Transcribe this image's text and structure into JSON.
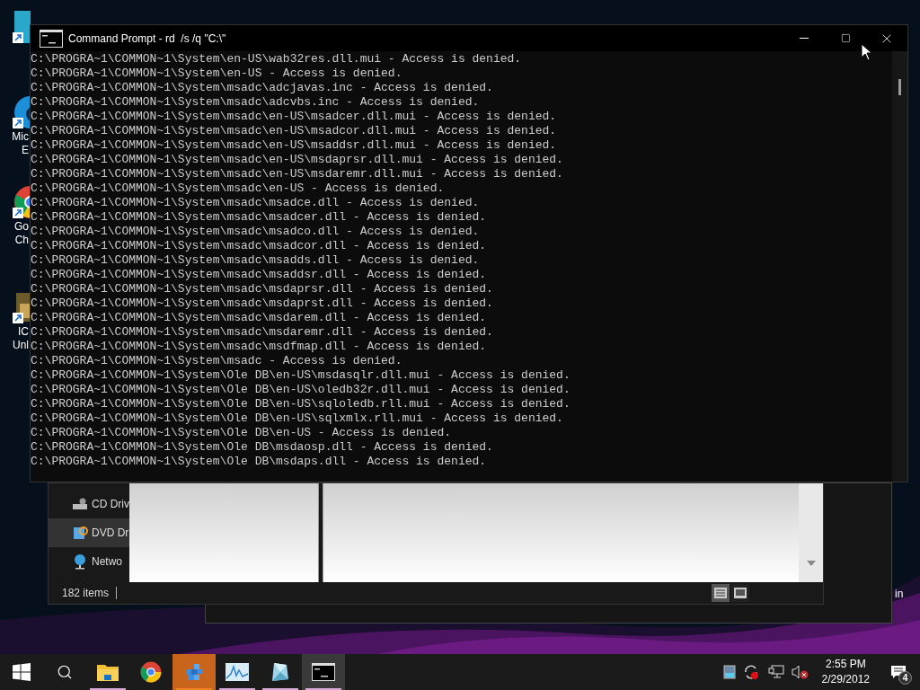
{
  "desktop": {
    "icons": [
      {
        "kind": "generic"
      },
      {
        "kind": "edge",
        "label_lines": [
          "Mic",
          "E"
        ]
      },
      {
        "kind": "chrome",
        "label_lines": [
          "Go",
          "Ch"
        ]
      },
      {
        "label_lines": [
          "IC",
          "Unl"
        ]
      }
    ],
    "right_label": "in"
  },
  "explorer": {
    "nav_items": [
      {
        "kind": "cd",
        "label": "CD Driv",
        "selected": false
      },
      {
        "kind": "dvd",
        "label": "DVD Dr",
        "selected": true
      },
      {
        "kind": "network",
        "label": "Netwo",
        "selected": false
      }
    ],
    "status": "182 items",
    "views": [
      {
        "kind": "details",
        "selected": true
      },
      {
        "kind": "tiles",
        "selected": false
      }
    ]
  },
  "console": {
    "title": "Command Prompt - rd  /s /q \"C:\\\"",
    "lines": [
      "C:\\PROGRA~1\\COMMON~1\\System\\en-US\\wab32res.dll.mui - Access is denied.",
      "C:\\PROGRA~1\\COMMON~1\\System\\en-US - Access is denied.",
      "C:\\PROGRA~1\\COMMON~1\\System\\msadc\\adcjavas.inc - Access is denied.",
      "C:\\PROGRA~1\\COMMON~1\\System\\msadc\\adcvbs.inc - Access is denied.",
      "C:\\PROGRA~1\\COMMON~1\\System\\msadc\\en-US\\msadcer.dll.mui - Access is denied.",
      "C:\\PROGRA~1\\COMMON~1\\System\\msadc\\en-US\\msadcor.dll.mui - Access is denied.",
      "C:\\PROGRA~1\\COMMON~1\\System\\msadc\\en-US\\msaddsr.dll.mui - Access is denied.",
      "C:\\PROGRA~1\\COMMON~1\\System\\msadc\\en-US\\msdaprsr.dll.mui - Access is denied.",
      "C:\\PROGRA~1\\COMMON~1\\System\\msadc\\en-US\\msdaremr.dll.mui - Access is denied.",
      "C:\\PROGRA~1\\COMMON~1\\System\\msadc\\en-US - Access is denied.",
      "C:\\PROGRA~1\\COMMON~1\\System\\msadc\\msadce.dll - Access is denied.",
      "C:\\PROGRA~1\\COMMON~1\\System\\msadc\\msadcer.dll - Access is denied.",
      "C:\\PROGRA~1\\COMMON~1\\System\\msadc\\msadco.dll - Access is denied.",
      "C:\\PROGRA~1\\COMMON~1\\System\\msadc\\msadcor.dll - Access is denied.",
      "C:\\PROGRA~1\\COMMON~1\\System\\msadc\\msadds.dll - Access is denied.",
      "C:\\PROGRA~1\\COMMON~1\\System\\msadc\\msaddsr.dll - Access is denied.",
      "C:\\PROGRA~1\\COMMON~1\\System\\msadc\\msdaprsr.dll - Access is denied.",
      "C:\\PROGRA~1\\COMMON~1\\System\\msadc\\msdaprst.dll - Access is denied.",
      "C:\\PROGRA~1\\COMMON~1\\System\\msadc\\msdarem.dll - Access is denied.",
      "C:\\PROGRA~1\\COMMON~1\\System\\msadc\\msdaremr.dll - Access is denied.",
      "C:\\PROGRA~1\\COMMON~1\\System\\msadc\\msdfmap.dll - Access is denied.",
      "C:\\PROGRA~1\\COMMON~1\\System\\msadc - Access is denied.",
      "C:\\PROGRA~1\\COMMON~1\\System\\Ole DB\\en-US\\msdasqlr.dll.mui - Access is denied.",
      "C:\\PROGRA~1\\COMMON~1\\System\\Ole DB\\en-US\\oledb32r.dll.mui - Access is denied.",
      "C:\\PROGRA~1\\COMMON~1\\System\\Ole DB\\en-US\\sqloledb.rll.mui - Access is denied.",
      "C:\\PROGRA~1\\COMMON~1\\System\\Ole DB\\en-US\\sqlxmlx.rll.mui - Access is denied.",
      "C:\\PROGRA~1\\COMMON~1\\System\\Ole DB\\en-US - Access is denied.",
      "C:\\PROGRA~1\\COMMON~1\\System\\Ole DB\\msdaosp.dll - Access is denied.",
      "C:\\PROGRA~1\\COMMON~1\\System\\Ole DB\\msdaps.dll - Access is denied."
    ]
  },
  "taskbar": {
    "apps": [
      {
        "kind": "folder",
        "running": true,
        "active": false,
        "attention": false
      },
      {
        "kind": "chrome",
        "running": false,
        "active": false,
        "attention": false
      },
      {
        "kind": "cubes",
        "running": true,
        "active": false,
        "attention": true
      },
      {
        "kind": "graph",
        "running": true,
        "active": false,
        "attention": false
      },
      {
        "kind": "crystal",
        "running": true,
        "active": false,
        "attention": false
      },
      {
        "kind": "console",
        "running": true,
        "active": true,
        "attention": false
      }
    ],
    "time": "2:55 PM",
    "date": "2/29/2012",
    "notification_count": "4"
  }
}
